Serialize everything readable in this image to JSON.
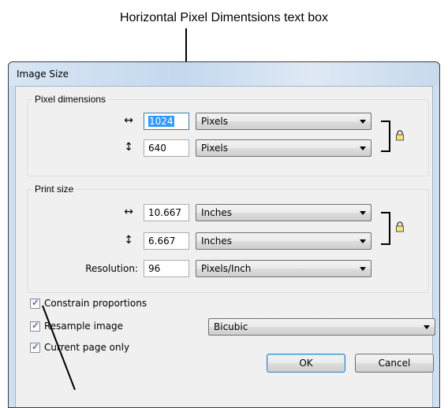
{
  "callout": {
    "text": "Horizontal Pixel Dimentsions text box"
  },
  "dialog": {
    "title": "Image Size",
    "pixel_dimensions": {
      "legend": "Pixel dimensions",
      "width_icon": "horizontal-arrow-icon",
      "width_glyph": "↔",
      "width_value": "1024",
      "width_unit": "Pixels",
      "height_icon": "vertical-arrow-icon",
      "height_glyph": "↕",
      "height_value": "640",
      "height_unit": "Pixels",
      "link_icon": "lock-icon"
    },
    "print_size": {
      "legend": "Print size",
      "width_glyph": "↔",
      "width_value": "10.667",
      "width_unit": "Inches",
      "height_glyph": "↕",
      "height_value": "6.667",
      "height_unit": "Inches",
      "resolution_label": "Resolution:",
      "resolution_value": "96",
      "resolution_unit": "Pixels/Inch",
      "link_icon": "lock-icon"
    },
    "options": {
      "constrain_label": "Constrain proportions",
      "constrain_checked": true,
      "resample_label": "Resample image",
      "resample_checked": true,
      "resample_method": "Bicubic",
      "current_page_label": "Current page only",
      "current_page_checked": true
    },
    "buttons": {
      "ok": "OK",
      "cancel": "Cancel"
    }
  }
}
